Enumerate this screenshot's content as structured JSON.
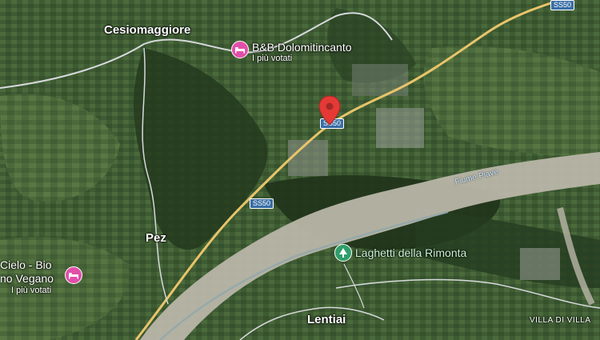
{
  "towns": {
    "cesiomaggiore": "Cesiomaggiore",
    "pez": "Pez",
    "lentiai": "Lentiai",
    "villa_di_villa": "VILLA DI VILLA"
  },
  "roads": {
    "ss50_top": "SS50",
    "ss50_mid": "SS50",
    "ss50_lower": "SS50"
  },
  "river": "Fiume Piave",
  "pois": {
    "bnb_dolomiti": {
      "name": "B&B Dolomitincanto",
      "sub": "I più votati",
      "icon": "bed-icon",
      "color": "#e14fa8"
    },
    "cielo_bio": {
      "name_line1": "Cielo - Bio",
      "name_line2": "no Vegano",
      "sub": "I più votati",
      "icon": "bed-icon",
      "color": "#e14fa8"
    },
    "laghetti": {
      "name": "Laghetti della Rimonta",
      "icon": "tree-icon",
      "color": "#2f9e6a"
    }
  },
  "marker": {
    "icon": "location-pin-icon",
    "color": "#e53935"
  }
}
